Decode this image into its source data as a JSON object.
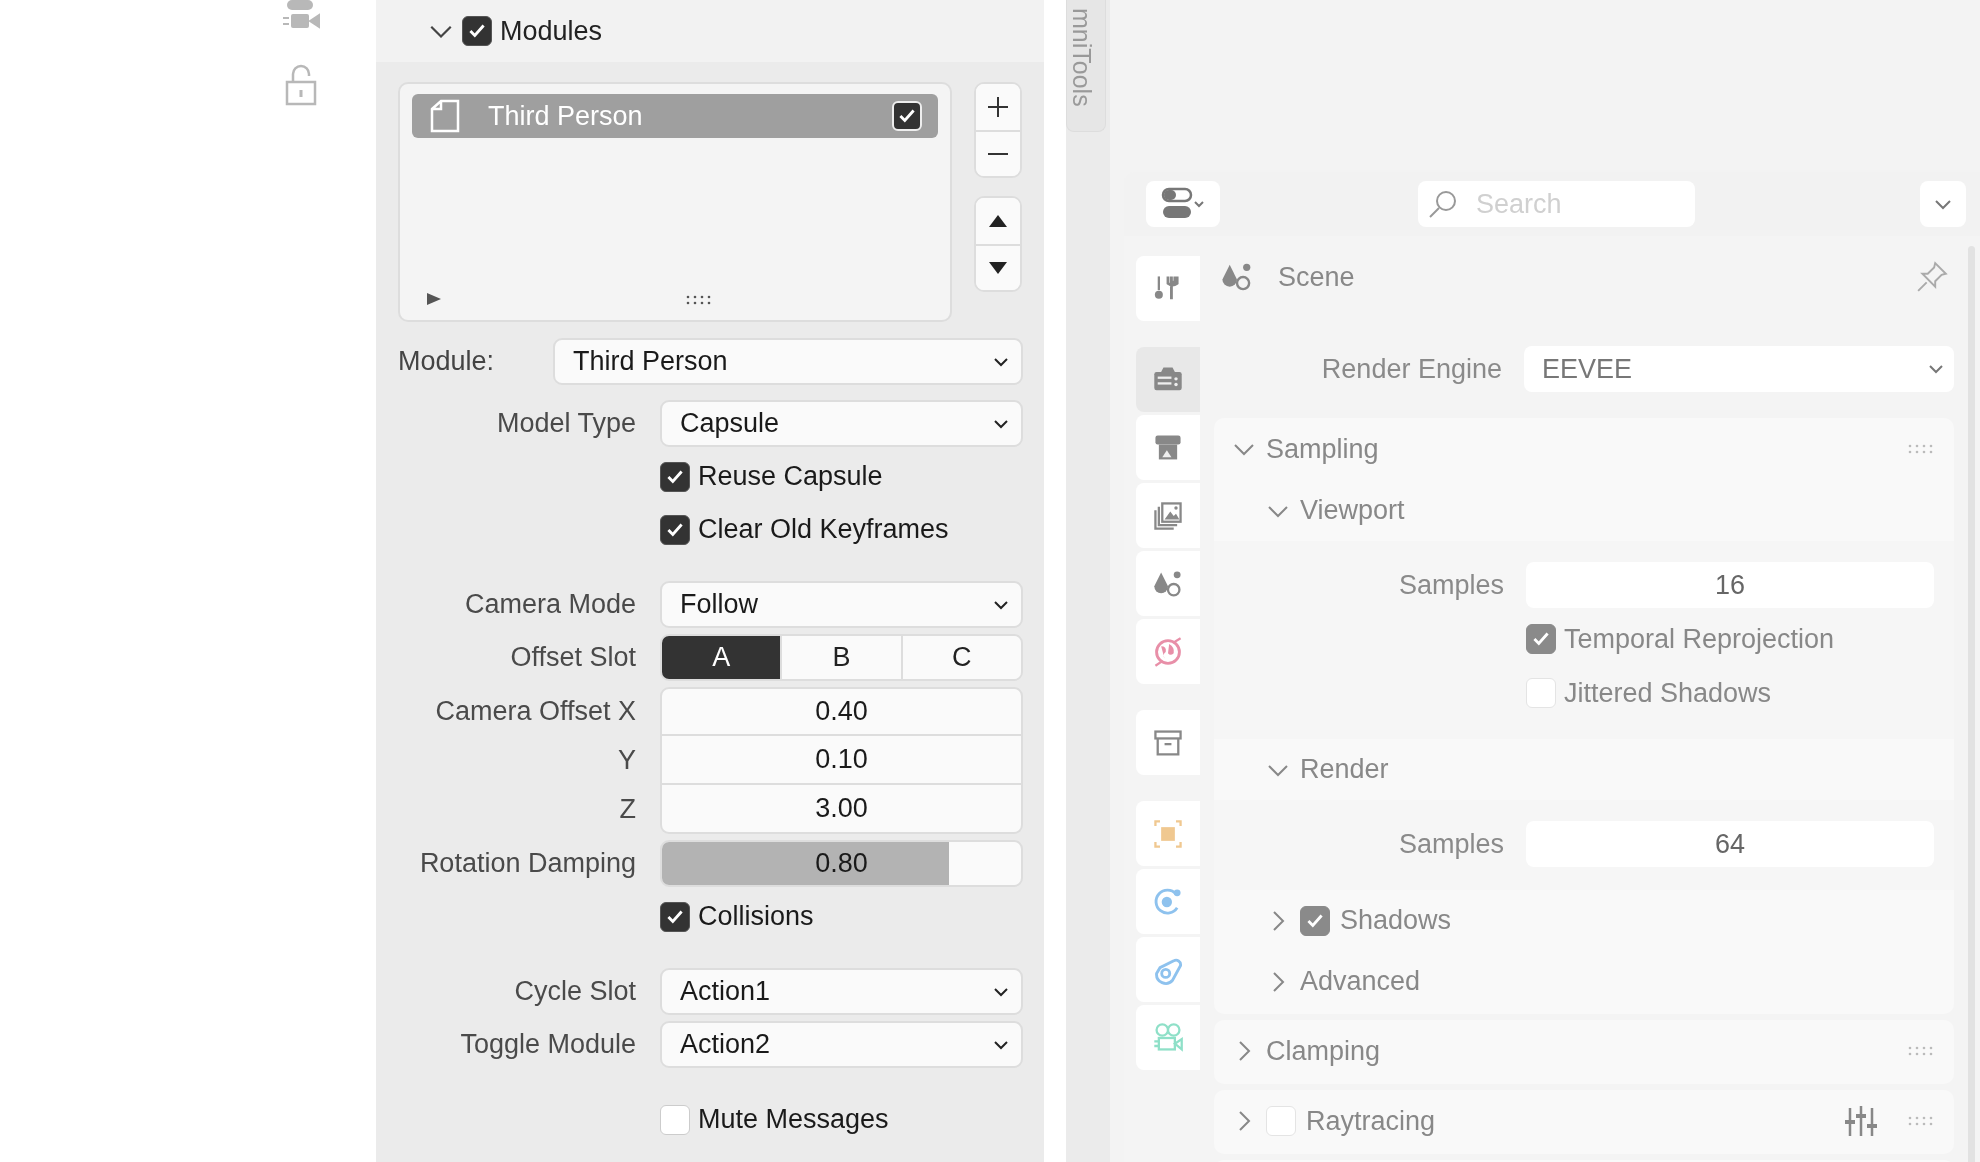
{
  "modules": {
    "label": "Modules",
    "expanded": true,
    "checked": true,
    "list": [
      {
        "label": "Third Person",
        "checked": true,
        "selected": true
      }
    ],
    "module": {
      "label": "Module:",
      "value": "Third Person"
    },
    "groups": [
      [
        {
          "kind": "dropdown",
          "label": "Model Type",
          "value": "Capsule"
        },
        {
          "kind": "checkbox",
          "label": "Reuse Capsule",
          "checked": true
        },
        {
          "kind": "checkbox",
          "label": "Clear Old Keyframes",
          "checked": true
        }
      ],
      [
        {
          "kind": "dropdown",
          "label": "Camera Mode",
          "value": "Follow"
        },
        {
          "kind": "segmented",
          "label": "Offset Slot",
          "options": [
            {
              "label": "A",
              "selected": true
            },
            {
              "label": "B",
              "selected": false
            },
            {
              "label": "C",
              "selected": false
            }
          ]
        },
        {
          "kind": "vector",
          "rows": [
            {
              "label": "Camera Offset X",
              "value": "0.40"
            },
            {
              "label": "Y",
              "value": "0.10"
            },
            {
              "label": "Z",
              "value": "3.00"
            }
          ]
        },
        {
          "kind": "slider",
          "label": "Rotation Damping",
          "value": "0.80",
          "level": 0.8
        },
        {
          "kind": "checkbox",
          "label": "Collisions",
          "checked": true
        }
      ],
      [
        {
          "kind": "dropdown",
          "label": "Cycle Slot",
          "value": "Action1"
        },
        {
          "kind": "dropdown",
          "label": "Toggle Module",
          "value": "Action2"
        }
      ],
      [
        {
          "kind": "checkbox",
          "label": "Mute Messages",
          "checked": false
        }
      ]
    ]
  },
  "sidebar_tab": {
    "label": "mniTools"
  },
  "properties": {
    "search": {
      "placeholder": "Search"
    },
    "tab_groups": [
      [
        {
          "selected": false
        }
      ],
      [
        {
          "selected": true
        },
        {
          "selected": false
        },
        {
          "selected": false
        },
        {
          "selected": false
        },
        {
          "selected": false
        }
      ],
      [
        {
          "selected": false
        }
      ],
      [
        {
          "selected": false
        },
        {
          "selected": false
        },
        {
          "selected": false
        },
        {
          "selected": false
        }
      ]
    ],
    "context": "Scene",
    "render_engine": {
      "label": "Render Engine",
      "value": "EEVEE"
    },
    "panels": [
      {
        "title": "Sampling",
        "expanded": true,
        "subpanels": [
          {
            "title": "Viewport",
            "expanded": true,
            "rows": [
              {
                "kind": "number",
                "label": "Samples",
                "value": "16"
              },
              {
                "kind": "checkbox",
                "label": "Temporal Reprojection",
                "checked": true
              },
              {
                "kind": "checkbox",
                "label": "Jittered Shadows",
                "checked": false
              }
            ]
          },
          {
            "title": "Render",
            "expanded": true,
            "rows": [
              {
                "kind": "number",
                "label": "Samples",
                "value": "64"
              }
            ]
          },
          {
            "title": "Shadows",
            "expanded": false,
            "checked": true
          },
          {
            "title": "Advanced",
            "expanded": false
          }
        ]
      },
      {
        "title": "Clamping",
        "expanded": false
      },
      {
        "title": "Raytracing",
        "expanded": false,
        "checked": false,
        "options": true
      }
    ]
  }
}
